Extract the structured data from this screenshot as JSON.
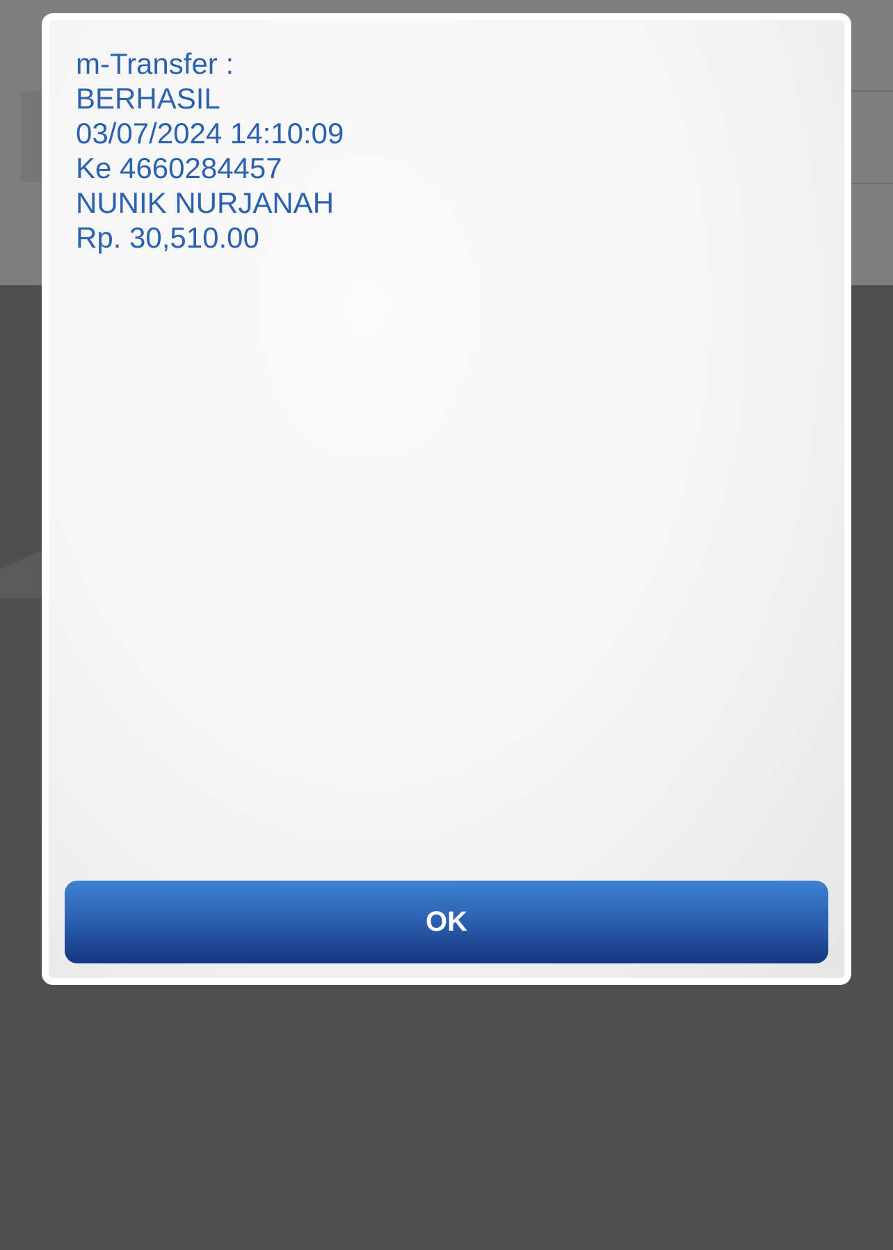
{
  "dialog": {
    "lines": [
      "m-Transfer :",
      "BERHASIL",
      "03/07/2024 14:10:09",
      "Ke 4660284457",
      "NUNIK NURJANAH",
      "Rp. 30,510.00"
    ],
    "ok_label": "OK"
  },
  "colors": {
    "message_text": "#2c62ad",
    "button_top": "#3d82d0",
    "button_bottom": "#17367f",
    "overlay_upper": "#7f7f7f",
    "overlay_lower": "#4f4f4f"
  }
}
